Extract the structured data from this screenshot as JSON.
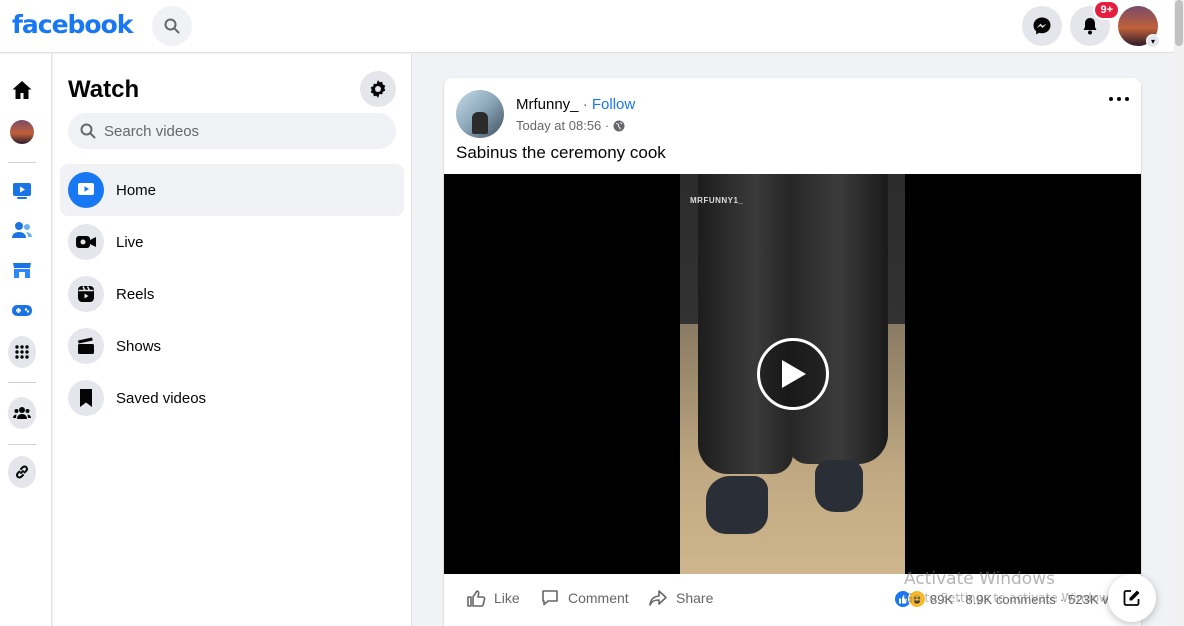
{
  "brand": {
    "logo_text": "facebook",
    "color": "#1877f2"
  },
  "topbar": {
    "search_icon": "search-icon",
    "messenger_icon": "messenger-icon",
    "notifications": {
      "icon": "bell-icon",
      "badge": "9+"
    },
    "profile_icon": "avatar"
  },
  "rail": {
    "items": [
      "home-icon",
      "profile-avatar",
      "watch-icon",
      "friends-icon",
      "marketplace-icon",
      "gaming-icon",
      "apps-grid-icon",
      "groups-icon",
      "link-icon"
    ]
  },
  "sidebar": {
    "title": "Watch",
    "settings_icon": "gear-icon",
    "search_placeholder": "Search videos",
    "items": [
      {
        "label": "Home",
        "icon": "watch-home-icon",
        "active": true
      },
      {
        "label": "Live",
        "icon": "live-camera-icon",
        "active": false
      },
      {
        "label": "Reels",
        "icon": "reels-icon",
        "active": false
      },
      {
        "label": "Shows",
        "icon": "clapper-icon",
        "active": false
      },
      {
        "label": "Saved videos",
        "icon": "bookmark-icon",
        "active": false
      }
    ]
  },
  "post": {
    "author": "Mrfunny_",
    "separator": "·",
    "follow_label": "Follow",
    "time": "Today at 08:56 ·",
    "privacy_icon": "globe-icon",
    "caption": "Sabinus the ceremony cook",
    "video_watermark": "MRFUNNY1_",
    "actions": {
      "like": "Like",
      "comment": "Comment",
      "share": "Share"
    },
    "stats": {
      "reactions": "89K",
      "sep1": "·",
      "comments": "8.9K comments",
      "sep2": "·",
      "views": "523K vi"
    }
  },
  "overlay": {
    "activate_title": "Activate Windows",
    "activate_sub": "Go to Settings to activate Windows."
  }
}
